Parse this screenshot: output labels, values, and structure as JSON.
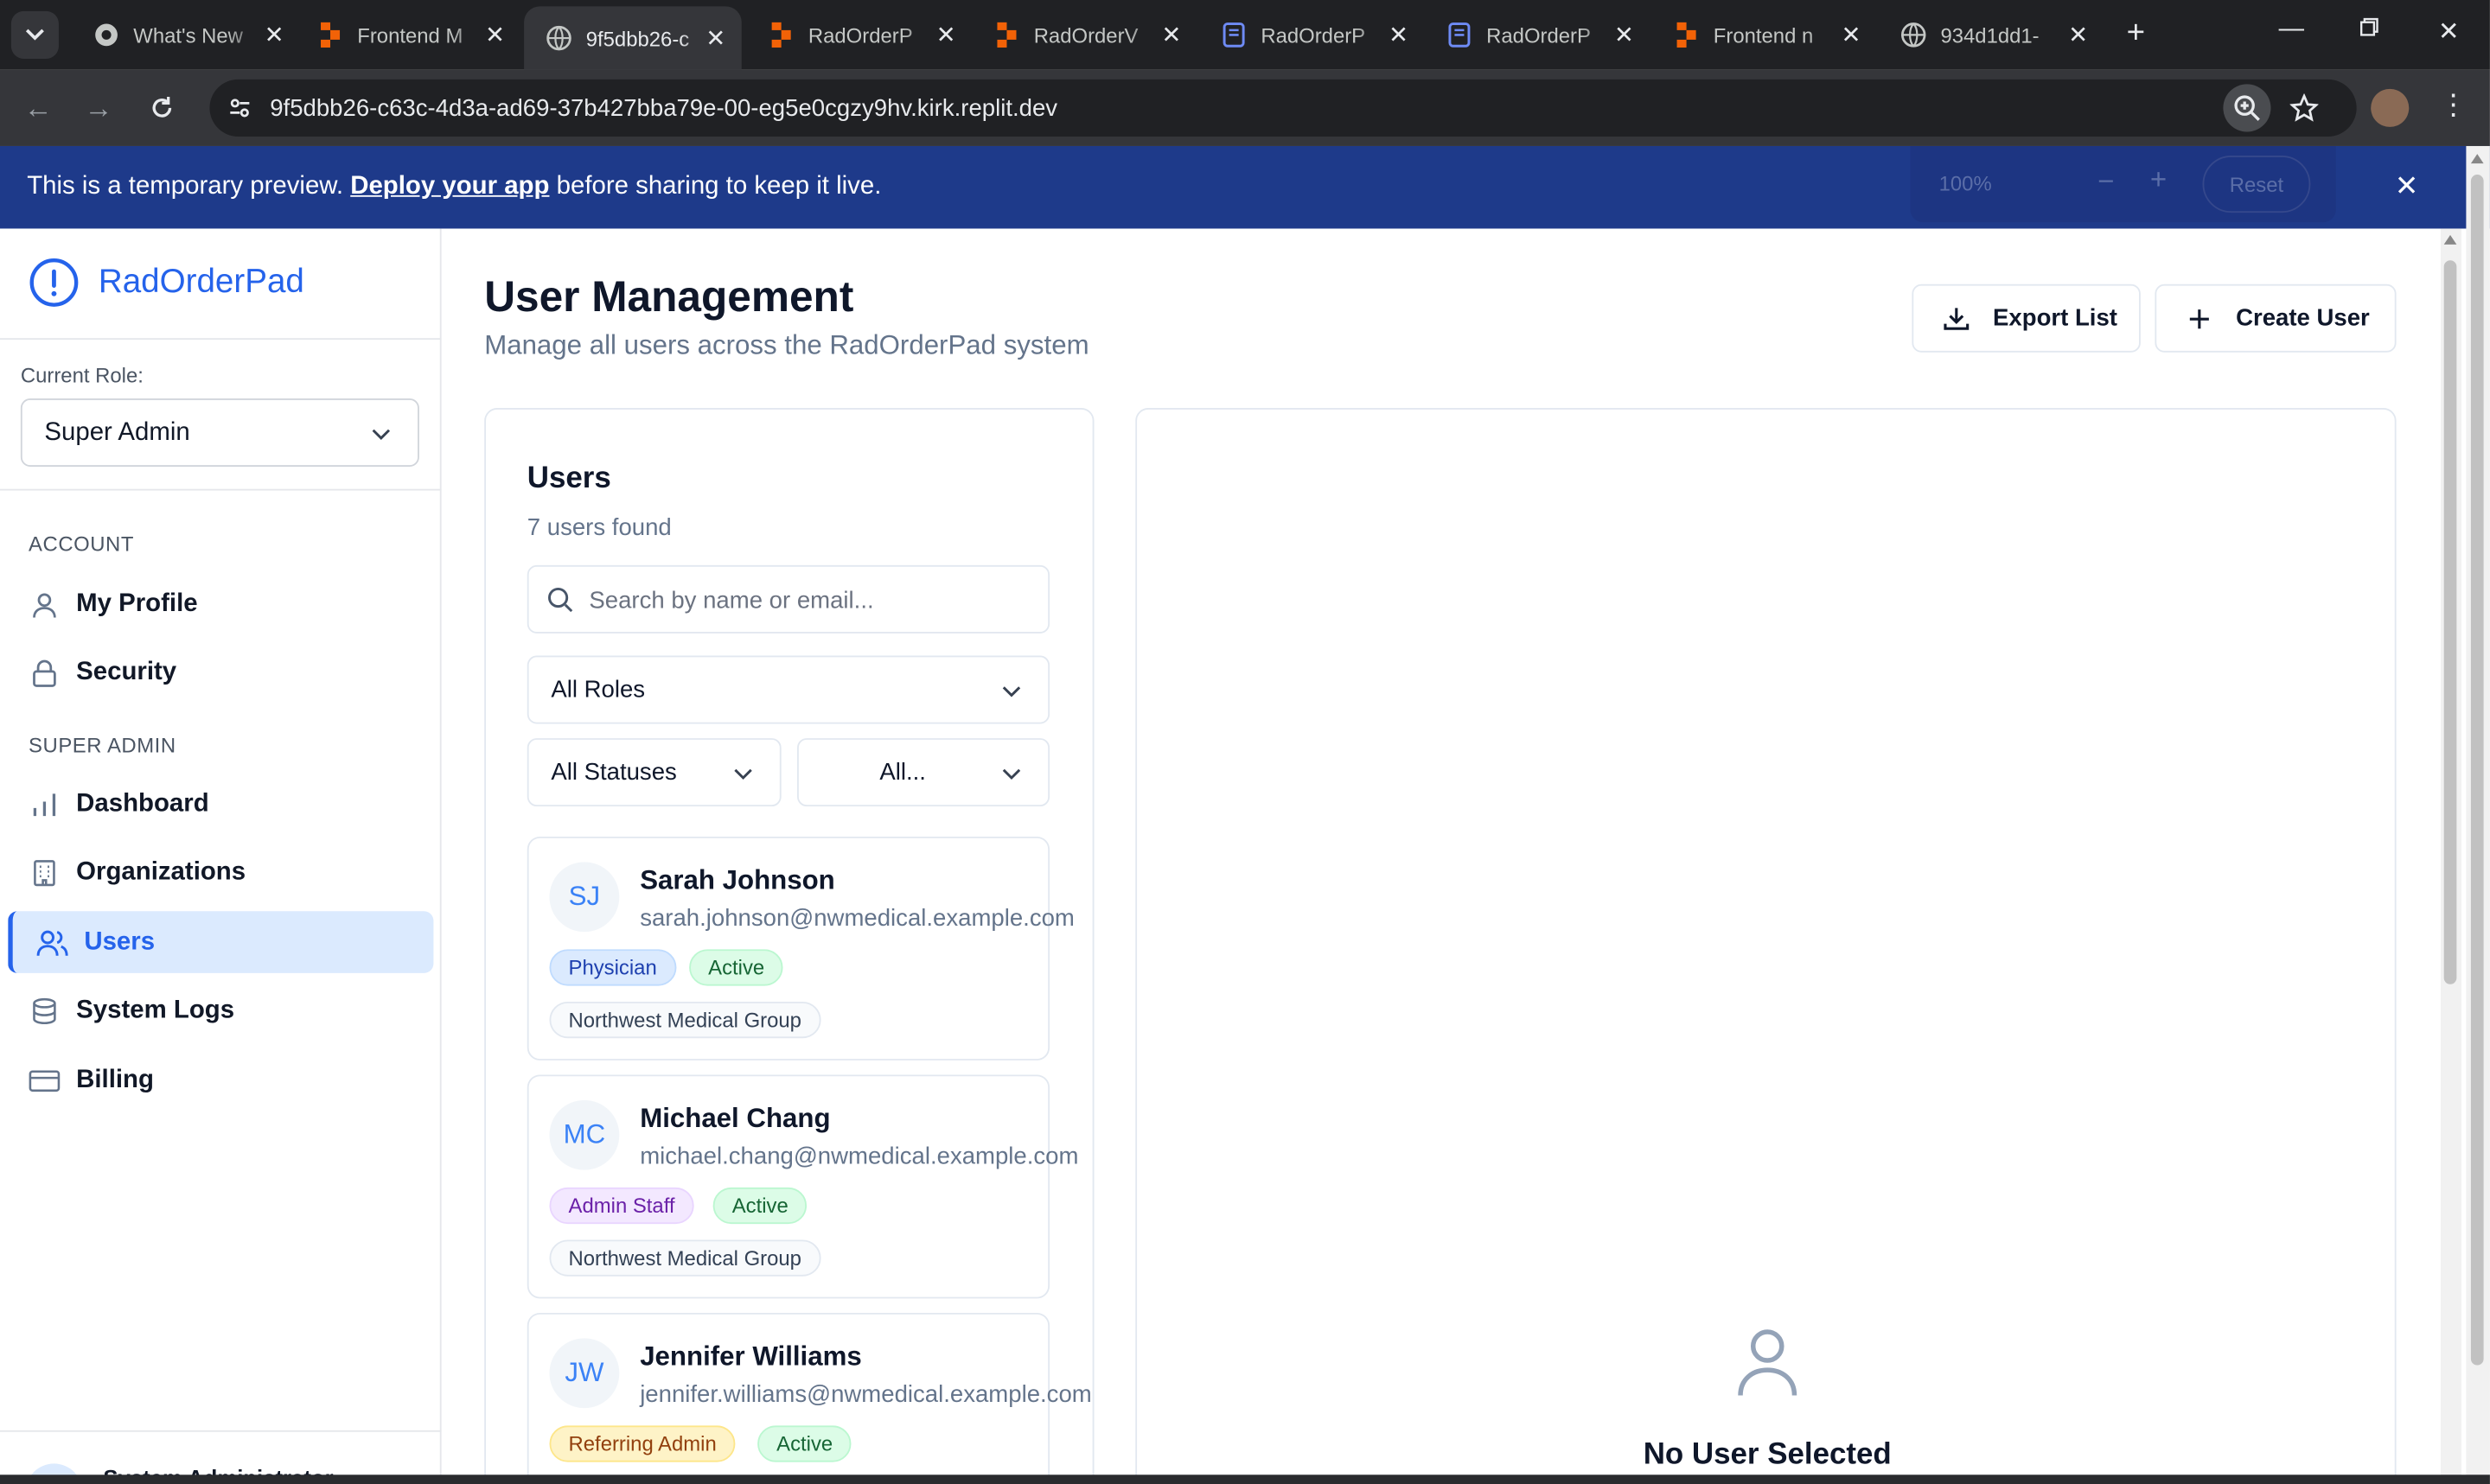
{
  "browser": {
    "tabs": [
      {
        "title": "What's New",
        "icon": "chrome-icon"
      },
      {
        "title": "Frontend M",
        "icon": "replit-icon"
      },
      {
        "title": "9f5dbb26-c",
        "icon": "globe-icon",
        "active": true
      },
      {
        "title": "RadOrderP",
        "icon": "replit-icon"
      },
      {
        "title": "RadOrderV",
        "icon": "replit-icon"
      },
      {
        "title": "RadOrderP",
        "icon": "doc-icon"
      },
      {
        "title": "RadOrderP",
        "icon": "doc-icon"
      },
      {
        "title": "Frontend n",
        "icon": "replit-icon"
      },
      {
        "title": "934d1dd1-",
        "icon": "globe-icon"
      }
    ],
    "url": "9f5dbb26-c63c-4d3a-ad69-37b427bba79e-00-eg5e0cgzy9hv.kirk.replit.dev"
  },
  "banner": {
    "text_before": "This is a temporary preview. ",
    "link": "Deploy your app",
    "text_after": " before sharing to keep it live.",
    "zoom_pct": "100%",
    "zoom_reset": "Reset"
  },
  "sidebar": {
    "brand": "RadOrderPad",
    "role_label": "Current Role:",
    "role_value": "Super Admin",
    "account_label": "ACCOUNT",
    "super_admin_label": "SUPER ADMIN",
    "account_items": [
      {
        "label": "My Profile",
        "icon": "user-icon"
      },
      {
        "label": "Security",
        "icon": "lock-icon"
      }
    ],
    "admin_items": [
      {
        "label": "Dashboard",
        "icon": "bar-chart-icon"
      },
      {
        "label": "Organizations",
        "icon": "building-icon"
      },
      {
        "label": "Users",
        "icon": "users-icon",
        "active": true
      },
      {
        "label": "System Logs",
        "icon": "database-icon"
      },
      {
        "label": "Billing",
        "icon": "credit-card-icon"
      }
    ],
    "footer_user": "System Administrator"
  },
  "main": {
    "title": "User Management",
    "subtitle": "Manage all users across the RadOrderPad system",
    "export_label": "Export List",
    "create_label": "Create User"
  },
  "users_panel": {
    "title": "Users",
    "count": "7 users found",
    "search_placeholder": "Search by name or email...",
    "role_filter": "All Roles",
    "status_filter": "All Statuses",
    "org_filter": "All..."
  },
  "users": [
    {
      "initials": "SJ",
      "name": "Sarah Johnson",
      "email": "sarah.johnson@nwmedical.example.com",
      "role": "Physician",
      "role_style": "b-phys",
      "status": "Active",
      "org": "Northwest Medical Group"
    },
    {
      "initials": "MC",
      "name": "Michael Chang",
      "email": "michael.chang@nwmedical.example.com",
      "role": "Admin Staff",
      "role_style": "b-admin",
      "status": "Active",
      "org": "Northwest Medical Group"
    },
    {
      "initials": "JW",
      "name": "Jennifer Williams",
      "email": "jennifer.williams@nwmedical.example.com",
      "role": "Referring Admin",
      "role_style": "b-ref",
      "status": "Active",
      "org": ""
    }
  ],
  "detail": {
    "empty_title": "No User Selected"
  },
  "colors": {
    "accent": "#2563eb",
    "banner": "#1e3a8a",
    "active_nav_bg": "#dbeafe"
  }
}
